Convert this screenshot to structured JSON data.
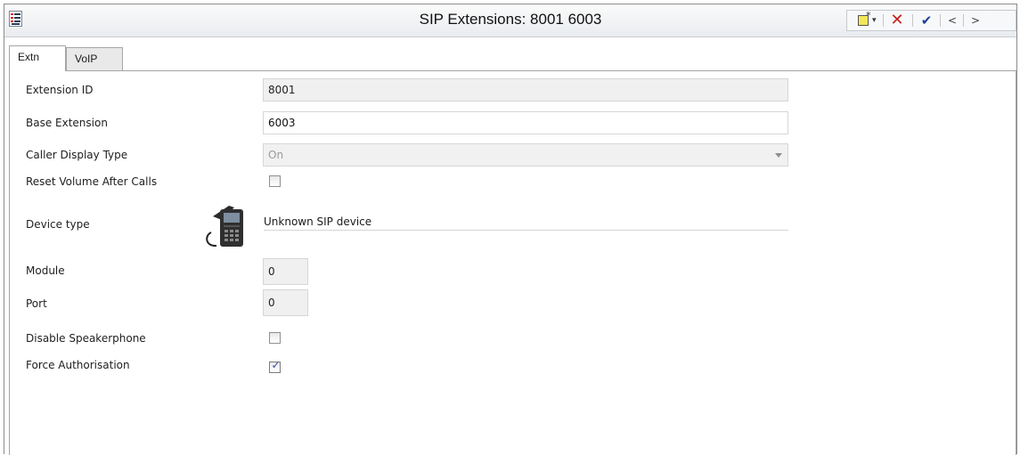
{
  "window": {
    "title": "SIP Extensions: 8001 6003",
    "toolbar": {
      "new_icon": "new-document-icon",
      "dropdown_glyph": "▾",
      "delete_glyph": "✕",
      "ok_glyph": "✔",
      "prev_glyph": "<",
      "next_glyph": ">"
    }
  },
  "tabs": [
    {
      "label": "Extn",
      "active": true
    },
    {
      "label": "VoIP",
      "active": false
    }
  ],
  "form": {
    "extension_id": {
      "label": "Extension ID",
      "value": "8001"
    },
    "base_extension": {
      "label": "Base Extension",
      "value": "6003"
    },
    "caller_display_type": {
      "label": "Caller Display Type",
      "value": "On"
    },
    "reset_volume": {
      "label": "Reset Volume After Calls",
      "checked": false
    },
    "device_type": {
      "label": "Device type",
      "value": "Unknown SIP device",
      "icon": "desk-phone-icon"
    },
    "module": {
      "label": "Module",
      "value": "0"
    },
    "port": {
      "label": "Port",
      "value": "0"
    },
    "disable_speakerphone": {
      "label": "Disable Speakerphone",
      "checked": false
    },
    "force_authorisation": {
      "label": "Force Authorisation",
      "checked": true
    }
  },
  "colors": {
    "delete": "#c81e1e",
    "ok": "#1d3f9e",
    "readonly_bg": "#f0f0f0"
  }
}
